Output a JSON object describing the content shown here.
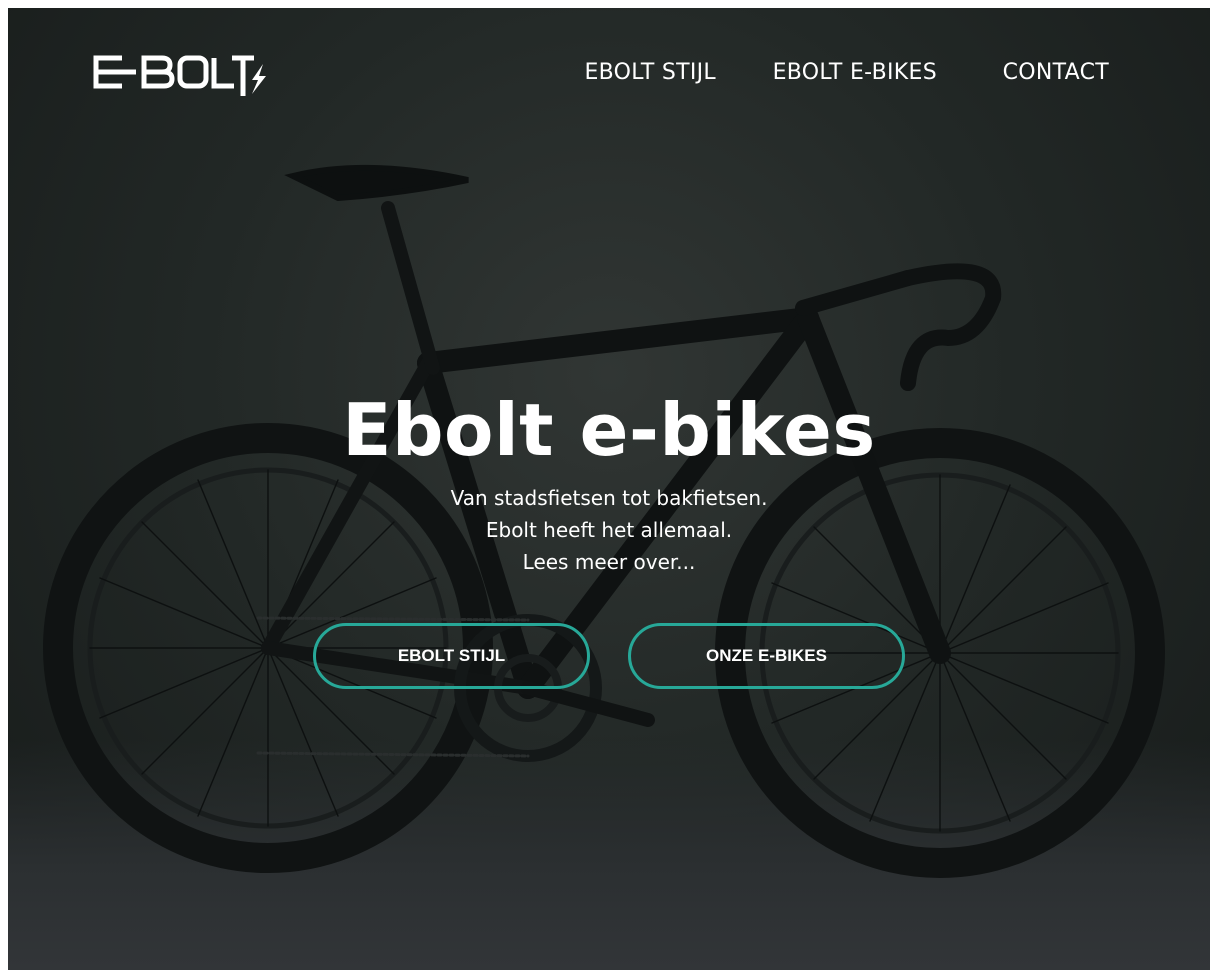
{
  "brand": {
    "logo_text": "E-BOLT",
    "logo_icon": "lightning-bolt-icon"
  },
  "nav": {
    "items": [
      {
        "label": "EBOLT STIJL"
      },
      {
        "label": "EBOLT E-BIKES"
      },
      {
        "label": "CONTACT"
      }
    ]
  },
  "hero": {
    "title": "Ebolt e-bikes",
    "subtitle_lines": [
      "Van stadsfietsen tot bakfietsen.",
      "Ebolt heeft het allemaal.",
      "Lees meer over..."
    ]
  },
  "buttons": {
    "primary_label": "EBOLT STIJL",
    "secondary_label": "ONZE E-BIKES"
  },
  "colors": {
    "accent": "#27a898",
    "text": "#ffffff",
    "background": "#222826"
  }
}
